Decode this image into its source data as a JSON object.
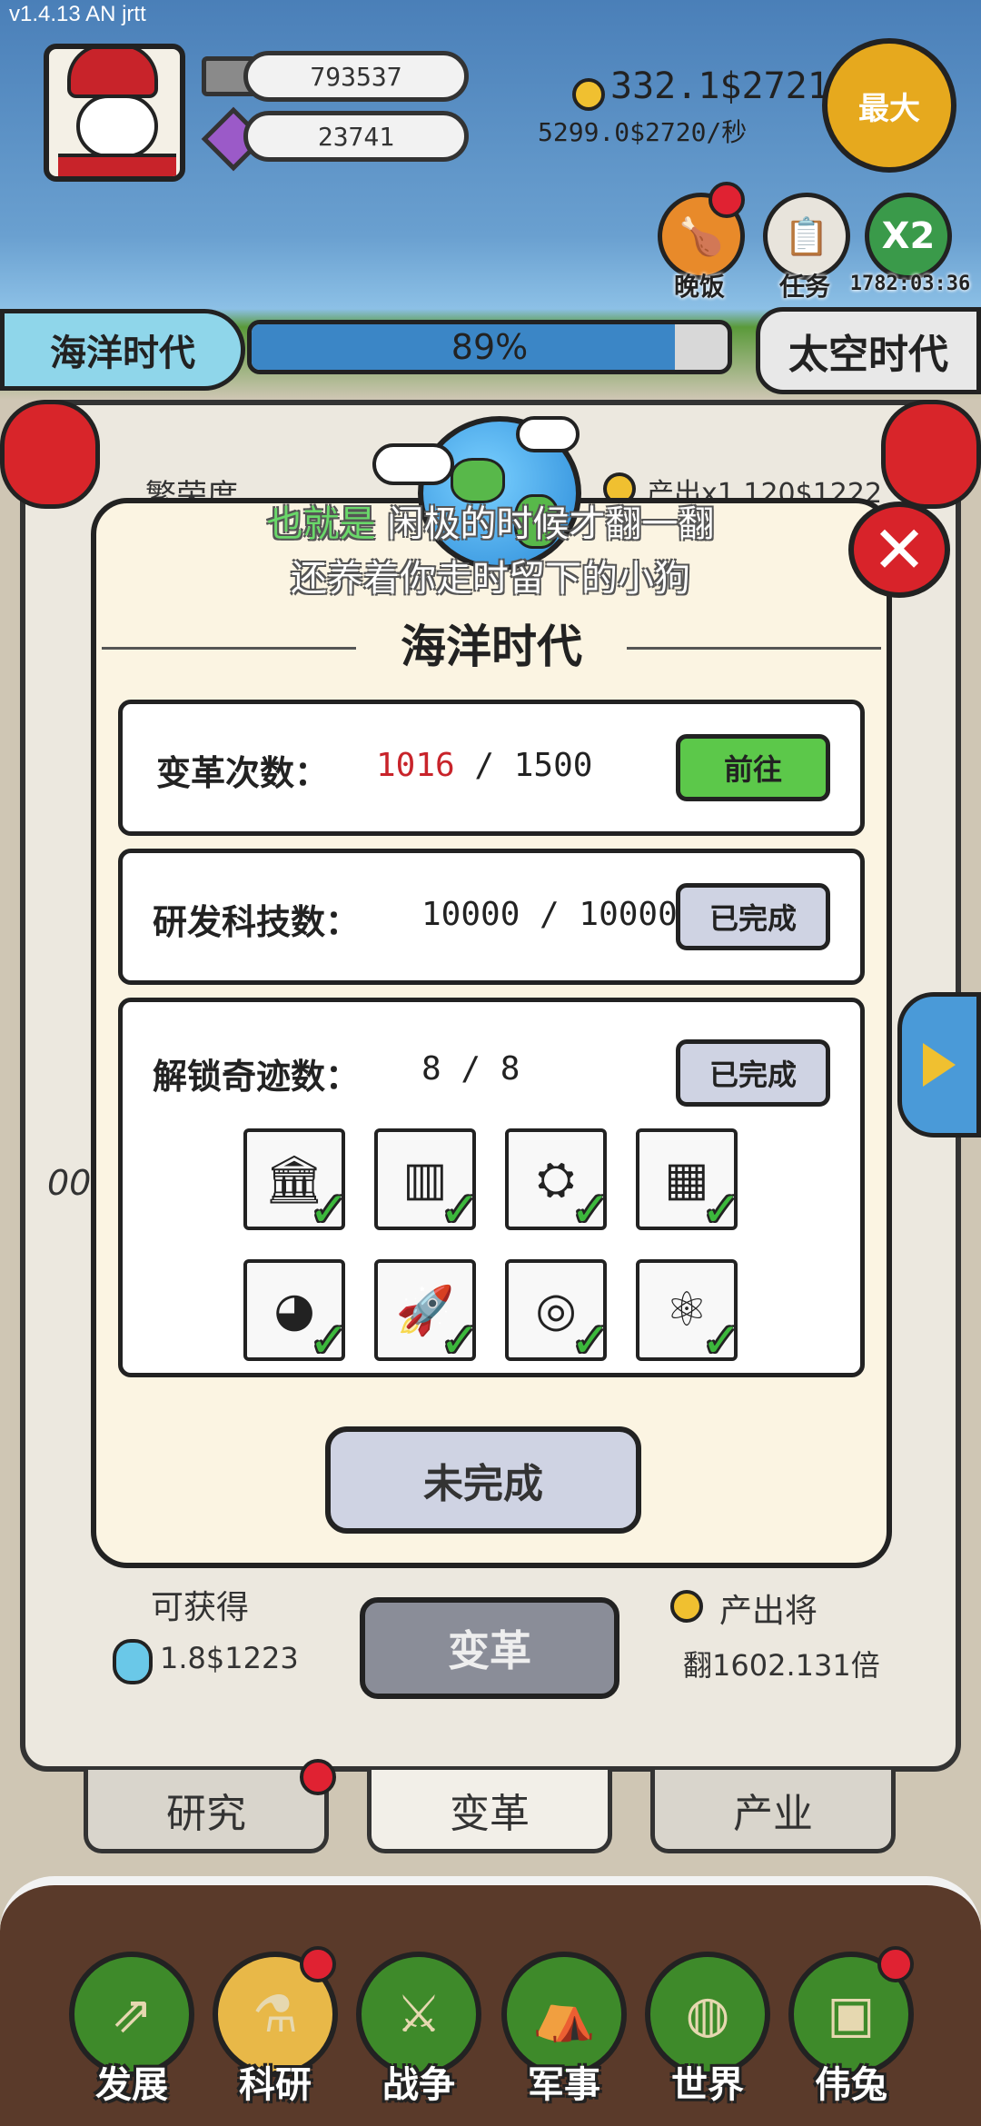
{
  "status_bar": {
    "version": "v1.4.13 AN jrtt"
  },
  "resources": {
    "silver": "793537",
    "gems": "23741",
    "coins": "332.1$2721",
    "coin_rate": "5299.0$2720/秒"
  },
  "hud_buttons": {
    "max_label": "最大",
    "dinner_label": "晚饭",
    "tasks_label": "任务",
    "x2_label": "X2",
    "x2_timer": "1782:03:36"
  },
  "era": {
    "current": "海洋时代",
    "next": "太空时代",
    "progress_text": "89%",
    "progress_value": 0.89
  },
  "background_panel": {
    "prosperity_label": "繁荣度",
    "output_text": "产出x1.120$1222",
    "side_number": "00",
    "obtain_label": "可获得",
    "obtain_value": "1.8$1223",
    "reform_button": "变革",
    "output_will_label": "产出将",
    "output_will_value": "翻1602.131倍"
  },
  "subtitle": {
    "line1_highlight": "也就是",
    "line1_rest": " 闲极的时候才翻一翻",
    "line2": "还养着你走时留下的小狗"
  },
  "modal": {
    "title": "海洋时代",
    "close_symbol": "✕",
    "requirements": [
      {
        "label": "变革次数：",
        "current": "1016",
        "separator": " / ",
        "target": "1500",
        "button": "前往"
      },
      {
        "label": "研发科技数：",
        "current": "10000",
        "separator": " / ",
        "target": "10000",
        "button": "已完成"
      },
      {
        "label": "解锁奇迹数：",
        "current": "8",
        "separator": " / ",
        "target": "8",
        "button": "已完成"
      }
    ],
    "wonders": [
      {
        "icon": "opera-house-icon"
      },
      {
        "icon": "dam-icon"
      },
      {
        "icon": "lunar-lander-icon"
      },
      {
        "icon": "server-rack-icon"
      },
      {
        "icon": "robot-icon"
      },
      {
        "icon": "space-station-icon"
      },
      {
        "icon": "ufo-icon"
      },
      {
        "icon": "atom-icon"
      }
    ],
    "status_button": "未完成"
  },
  "tabs": [
    "研究",
    "变革",
    "产业"
  ],
  "bottom_nav": [
    "发展",
    "科研",
    "战争",
    "军事",
    "世界",
    "伟兔"
  ],
  "colors": {
    "progress_fill": "#3b86c6",
    "go_button": "#5cc84a",
    "done_button": "#cfd3e3",
    "current_count": "#c8232a",
    "close_button": "#d8232a"
  }
}
